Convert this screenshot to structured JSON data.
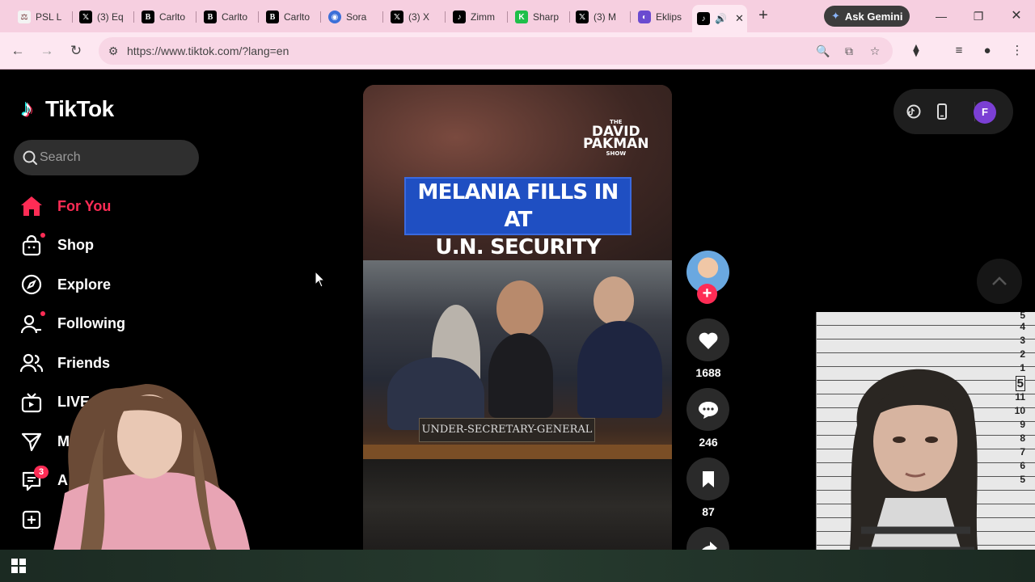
{
  "browser": {
    "tabs": [
      {
        "label": "PSL L",
        "icon": "scales-icon",
        "color": "#5a2a2a"
      },
      {
        "label": "(3) Eq",
        "icon": "x-logo-icon",
        "color": "#000000"
      },
      {
        "label": "Carlto",
        "icon": "b-logo-icon",
        "color": "#000000"
      },
      {
        "label": "Carlto",
        "icon": "b-logo-icon",
        "color": "#000000"
      },
      {
        "label": "Carlto",
        "icon": "b-logo-icon",
        "color": "#000000"
      },
      {
        "label": "Sora",
        "icon": "sora-icon",
        "color": "#3b6fd8"
      },
      {
        "label": "(3) X",
        "icon": "x-logo-icon",
        "color": "#000000"
      },
      {
        "label": "Zimm",
        "icon": "tiktok-icon",
        "color": "#000000"
      },
      {
        "label": "Sharp",
        "icon": "k-logo-icon",
        "color": "#1fbf4a"
      },
      {
        "label": "(3) M",
        "icon": "x-logo-icon",
        "color": "#000000"
      },
      {
        "label": "Eklips",
        "icon": "eklips-icon",
        "color": "#6a4bd0"
      }
    ],
    "active_tab": {
      "icon": "tiktok-icon",
      "audio": "speaker-icon"
    },
    "ask_gemini": "Ask Gemini",
    "url": "https://www.tiktok.com/?lang=en"
  },
  "tiktok": {
    "logo_text": "TikTok",
    "search_placeholder": "Search",
    "nav": [
      {
        "label": "For You",
        "icon": "home-icon",
        "active": true
      },
      {
        "label": "Shop",
        "icon": "shop-bag-icon",
        "dot": true
      },
      {
        "label": "Explore",
        "icon": "compass-icon"
      },
      {
        "label": "Following",
        "icon": "following-user-icon",
        "dot": true
      },
      {
        "label": "Friends",
        "icon": "friends-icon"
      },
      {
        "label": "LIVE",
        "icon": "live-tv-icon"
      },
      {
        "label": "Messa",
        "icon": "paper-plane-icon"
      },
      {
        "label": "A",
        "icon": "activity-icon",
        "badge": "3"
      },
      {
        "label": "",
        "icon": "upload-plus-icon"
      }
    ],
    "video": {
      "brand_line1": "THE",
      "brand_line2": "DAVID",
      "brand_line3": "PAKMAN",
      "brand_line4": "SHOW",
      "headline_line1": "MELANIA FILLS IN AT",
      "headline_line2": "U.N. SECURITY COUNCIL",
      "placard": "UNDER-SECRETARY-GENERAL"
    },
    "actions": {
      "likes": "1688",
      "comments": "246",
      "saves": "87"
    },
    "profile_initial": "F"
  },
  "mugshot": {
    "height_marks": [
      "5",
      "4",
      "3",
      "2",
      "1",
      "5",
      "11",
      "10",
      "9",
      "8",
      "7",
      "6",
      "5"
    ]
  },
  "colors": {
    "accent": "#fe2c55",
    "tabstrip": "#f6cfe0",
    "toolbar": "#fde7f1"
  }
}
